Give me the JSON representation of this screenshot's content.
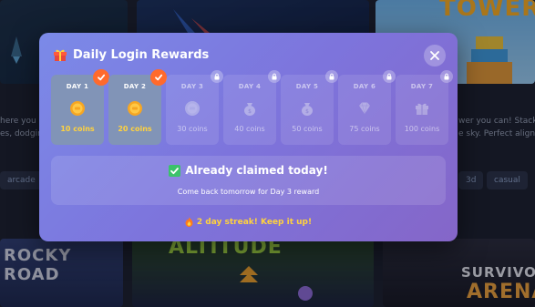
{
  "background": {
    "bg_text_left": "here you p",
    "bg_text_left2": "es, dodgin",
    "bg_text_right": "wer you can! Stack b",
    "bg_text_right2": "e sky. Perfect alignm",
    "tag_left": "arcade",
    "tags_right": [
      "3d",
      "casual"
    ],
    "tile_titles": {
      "top_right": "TOWER",
      "bottom_left": "ROCKY ROAD",
      "bottom_mid": "ALTITUDE",
      "bottom_right_1": "SURVIVOR",
      "bottom_right_2": "ARENA"
    }
  },
  "modal": {
    "title": "Daily Login Rewards",
    "title_icon": "gift-icon",
    "close_icon": "close-icon",
    "days": [
      {
        "label": "DAY 1",
        "reward": "10 coins",
        "state": "claimed",
        "icon": "coin-icon"
      },
      {
        "label": "DAY 2",
        "reward": "20 coins",
        "state": "claimed",
        "icon": "coin-icon"
      },
      {
        "label": "DAY 3",
        "reward": "30 coins",
        "state": "locked",
        "icon": "coin-icon"
      },
      {
        "label": "DAY 4",
        "reward": "40 coins",
        "state": "locked",
        "icon": "money-bag-icon"
      },
      {
        "label": "DAY 5",
        "reward": "50 coins",
        "state": "locked",
        "icon": "money-bag-icon"
      },
      {
        "label": "DAY 6",
        "reward": "75 coins",
        "state": "locked",
        "icon": "gem-icon"
      },
      {
        "label": "DAY 7",
        "reward": "100 coins",
        "state": "locked",
        "icon": "gift-icon"
      }
    ],
    "claimed_title": "Already claimed today!",
    "claimed_subtitle": "Come back tomorrow for Day 3 reward",
    "streak_text": "2 day streak! Keep it up!",
    "colors": {
      "accent": "#ff6a2c",
      "coin": "#ffd23e",
      "check": "#3cc26b"
    }
  }
}
